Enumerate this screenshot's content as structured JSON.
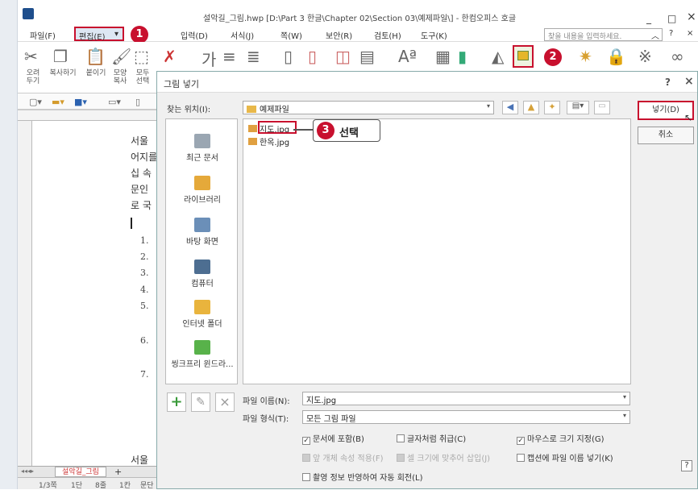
{
  "window": {
    "title": "설악길_그림.hwp [D:\\Part 3 한글\\Chapter 02\\Section 03\\예제파일\\] - 한컴오피스 호글",
    "min": "_",
    "max": "□",
    "close": "×"
  },
  "menu": {
    "file": "파일(F)",
    "edit": "편집(E)",
    "edit_arrow": "▾",
    "insert": "입력(D)",
    "format": "서식(J)",
    "page": "쪽(W)",
    "security": "보안(R)",
    "review": "검토(H)",
    "tools": "도구(K)",
    "search_placeholder": "찾을 내용을 입력하세요.",
    "help_up": "︿",
    "help_q": "?",
    "help_x": "×"
  },
  "toolbar": {
    "cut_label": "오려\n두기",
    "copy_label": "복사하기",
    "paste_label": "붙이기",
    "format_copy_label": "모양\n복사",
    "select_all_label": "모두\n선택"
  },
  "document": {
    "lines": [
      "서울",
      "어지를",
      "십 속",
      "문인",
      "로 국"
    ],
    "numbers": [
      "1.",
      "2.",
      "3.",
      "4.",
      "5.",
      "6.",
      "7."
    ],
    "bottom_line": "서울",
    "tab_name": "설악길_그림",
    "tab_add": "+",
    "status_page": "1/3쪽",
    "status_section": "1단",
    "status_line": "8줄",
    "status_col": "1칸",
    "status_extra": "문단"
  },
  "dialog": {
    "title": "그림 넣기",
    "help": "?",
    "close": "×",
    "look_in_label": "찾는 위치(I):",
    "look_in_value": "예제파일",
    "places": [
      {
        "label": "최근 문서",
        "color": "#9aa6b2"
      },
      {
        "label": "라이브러리",
        "color": "#e5a93a"
      },
      {
        "label": "바탕 화면",
        "color": "#6b8fb8"
      },
      {
        "label": "컴퓨터",
        "color": "#4d6e91"
      },
      {
        "label": "인터넷 폴더",
        "color": "#e9b43d"
      },
      {
        "label": "씽크프리 윈드라...",
        "color": "#58b24a"
      }
    ],
    "files": [
      "지도.jpg",
      "한옥.jpg"
    ],
    "filename_label": "파일 이름(N):",
    "filename_value": "지도.jpg",
    "filetype_label": "파일 형식(T):",
    "filetype_value": "모든 그림 파일",
    "insert_button": "넣기(D)",
    "cancel_button": "취소",
    "options": {
      "embed": "문서에 포함(B)",
      "as_char": "글자처럼 취급(C)",
      "mouse_size": "마우스로 크기 지정(G)",
      "keep_props": "앞 개체 속성 적용(F)",
      "fit_cell": "셀 크기에 맞추어 삽입(J)",
      "caption_name": "캡션에 파일 이름 넣기(K)",
      "rotate_exif": "촬영 정보 반영하여 자동 회전(L)"
    },
    "add_btn": "+",
    "edit_btn": "✎",
    "delete_btn": "×",
    "help_corner": "?"
  },
  "annotations": {
    "step1": "1",
    "step2": "2",
    "step3": "3",
    "step3_text": "선택"
  },
  "colors": {
    "accent_red": "#c8102e",
    "title_blue": "#1e4e8c"
  }
}
